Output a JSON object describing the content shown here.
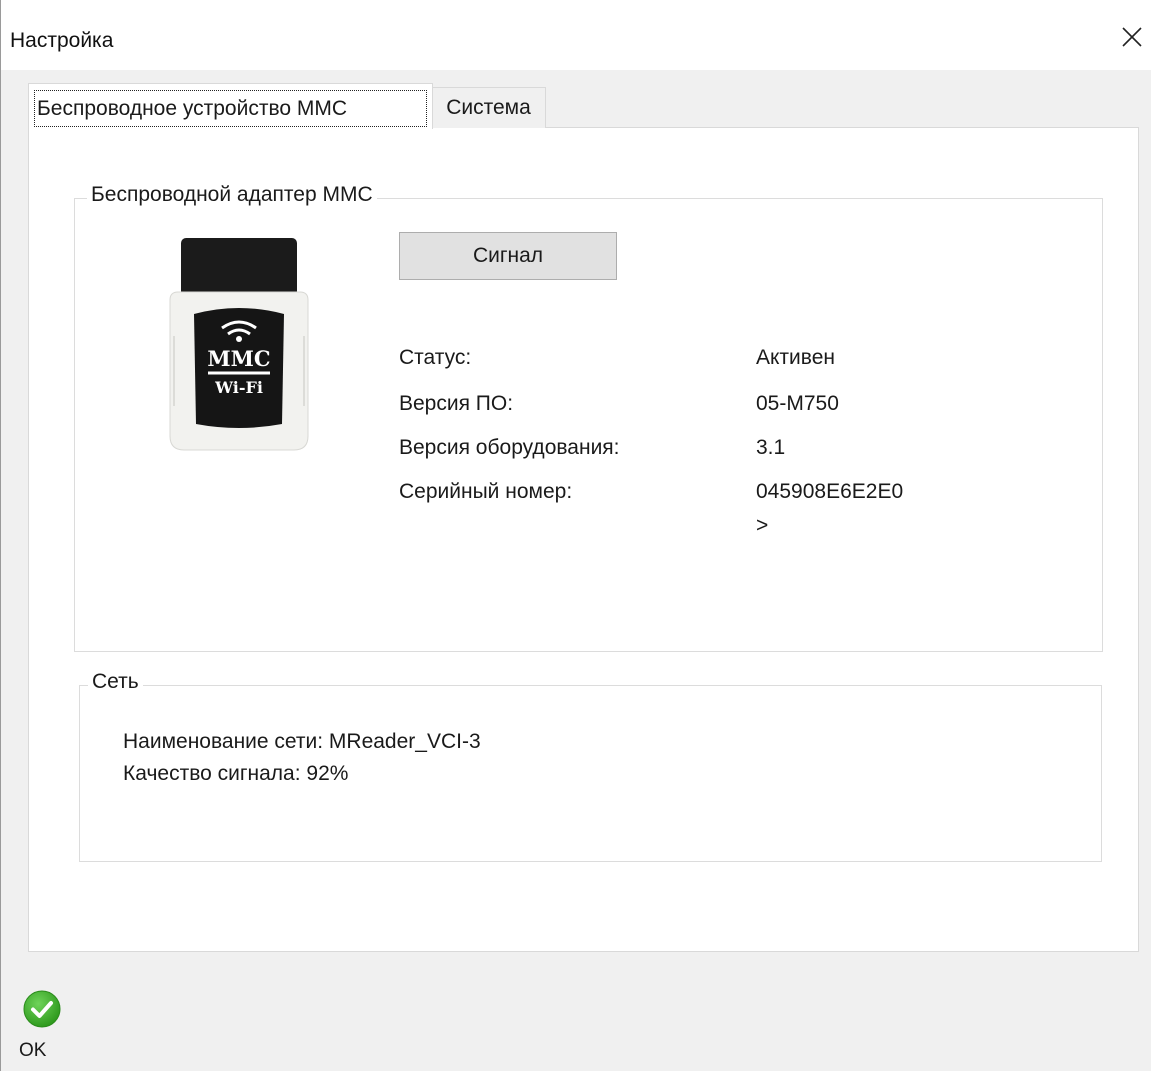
{
  "window": {
    "title": "Настройка",
    "close_icon": "close-icon"
  },
  "tabs": [
    {
      "label": "Беспроводное устройство MMC",
      "active": true
    },
    {
      "label": "Система",
      "active": false
    }
  ],
  "adapter_group": {
    "legend": "Беспроводной адаптер MMC",
    "device_image": {
      "brand": "MMC",
      "sublabel": "Wi-Fi",
      "icon": "wifi-adapter-icon"
    },
    "signal_button": "Сигнал",
    "info": [
      {
        "label": "Статус:",
        "value": "Активен"
      },
      {
        "label": "Версия ПО:",
        "value": "05-M750"
      },
      {
        "label": "Версия оборудования:",
        "value": "3.1"
      },
      {
        "label": "Серийный номер:",
        "value": "045908E6E2E0",
        "value_line2": ">"
      }
    ]
  },
  "network_group": {
    "legend": "Сеть",
    "lines": [
      "Наименование сети: MReader_VCI-3",
      "Качество сигнала: 92%"
    ]
  },
  "footer": {
    "ok_label": "OK",
    "ok_icon": "checkmark-icon",
    "ok_color": "#3fae2a"
  }
}
